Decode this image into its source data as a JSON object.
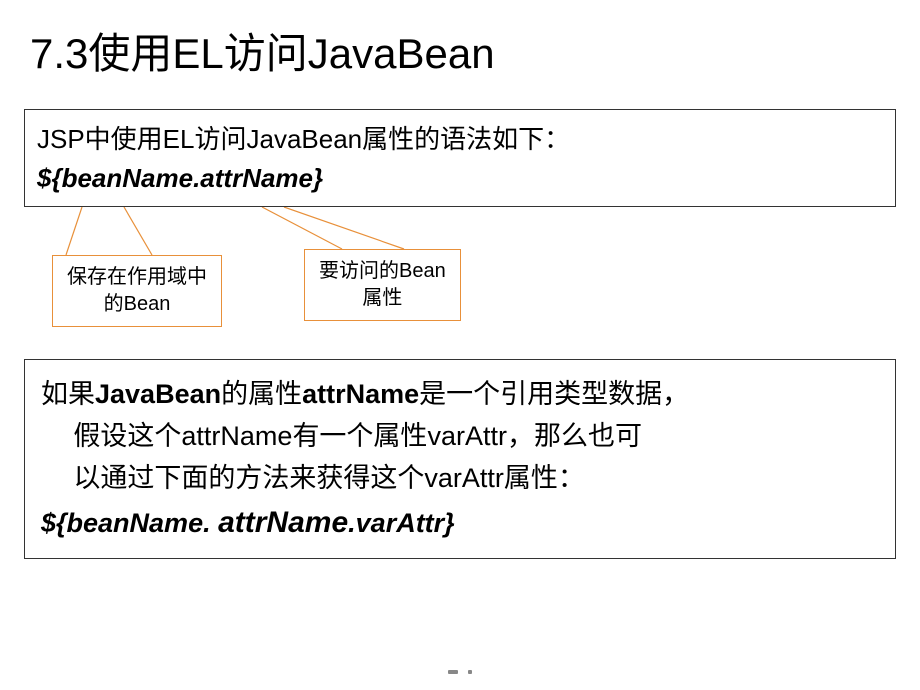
{
  "title": "7.3使用EL访问JavaBean",
  "box1": {
    "line1": "JSP中使用EL访问JavaBean属性的语法如下：",
    "syntax": "${beanName.attrName}"
  },
  "callouts": {
    "left_l1": "保存在作用域中",
    "left_l2": "的Bean",
    "right_l1": "要访问的Bean",
    "right_l2": "属性"
  },
  "box2": {
    "p1_a": "如果",
    "p1_b": "JavaBean",
    "p1_c": "的属性",
    "p1_d": "attrName",
    "p1_e": "是一个引用类型数据，",
    "p2_a": "假设这个",
    "p2_b": "attrName",
    "p2_c": "有一个属性",
    "p2_d": "varAttr",
    "p2_e": "，那么也可",
    "p3_a": "以通过下面的方法来获得这个",
    "p3_b": "varAttr",
    "p3_c": "属性：",
    "syntax_a": "${beanName. ",
    "syntax_b": "attrName",
    "syntax_c": ".varAttr}"
  }
}
